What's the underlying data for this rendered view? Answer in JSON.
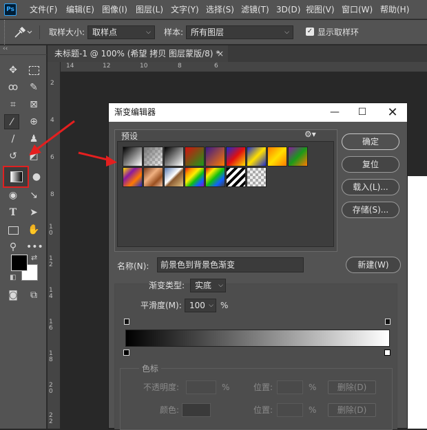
{
  "app": {
    "logo": "Ps"
  },
  "menu": [
    "文件(F)",
    "编辑(E)",
    "图像(I)",
    "图层(L)",
    "文字(Y)",
    "选择(S)",
    "滤镜(T)",
    "3D(D)",
    "视图(V)",
    "窗口(W)",
    "帮助(H)"
  ],
  "options": {
    "tool_icon": "eyedropper-icon",
    "sample_size_label": "取样大小:",
    "sample_size_value": "取样点",
    "sample_label": "样本:",
    "sample_value": "所有图层",
    "show_ring_label": "显示取样环",
    "show_ring_checked": true
  },
  "toolbar": {
    "collapse": "‹‹",
    "tools": [
      "move-icon",
      "marquee-icon",
      "lasso-icon",
      "quick-select-icon",
      "crop-icon",
      "frame-icon",
      "eyedropper-icon",
      "healing-icon",
      "brush-icon",
      "stamp-icon",
      "history-brush-icon",
      "eraser-icon",
      "gradient-icon",
      "blur-icon",
      "dodge-icon",
      "pen-icon",
      "type-icon",
      "path-select-icon",
      "rectangle-icon",
      "hand-icon",
      "zoom-icon",
      "more-icon"
    ],
    "foreground_color": "#000000",
    "background_color": "#ffffff"
  },
  "document": {
    "tab_title": "未标题-1 @ 100% (希望 拷贝 图层蒙版/8) *",
    "tab_close": "×",
    "ruler_top": [
      "14",
      "12",
      "10",
      "8",
      "6"
    ],
    "ruler_left": [
      "2",
      "4",
      "6",
      "8",
      "1 0",
      "1 2",
      "1 4",
      "1 6",
      "1 8",
      "2 0",
      "2 2"
    ]
  },
  "dialog": {
    "title": "渐变编辑器",
    "presets_label": "预设",
    "presets_menu_icon": "gear-icon",
    "buttons": {
      "ok": "确定",
      "reset": "复位",
      "load": "载入(L)...",
      "save": "存储(S)...",
      "new": "新建(W)"
    },
    "name_label": "名称(N):",
    "name_value": "前景色到背景色渐变",
    "gradient_type_label": "渐变类型:",
    "gradient_type_value": "实底",
    "smoothness_label": "平滑度(M):",
    "smoothness_value": "100",
    "smoothness_unit": "%",
    "stops_group_label": "色标",
    "opacity_label": "不透明度:",
    "opacity_unit": "%",
    "location_label": "位置:",
    "location_unit": "%",
    "delete_label": "删除(D)",
    "color_label": "颜色:",
    "location_label_2": "位置:",
    "location_unit_2": "%",
    "delete_label_2": "删除(D)"
  },
  "presets": [
    {
      "name": "fg-to-bg",
      "css": "linear-gradient(135deg,#000 0%,#fff 100%)"
    },
    {
      "name": "fg-to-transparent",
      "css": "linear-gradient(135deg,#777 0%,transparent 100%), repeating-conic-gradient(#bbb 0 25%,#eee 0 50%) 0 0/8px 8px"
    },
    {
      "name": "black-white",
      "css": "linear-gradient(135deg,#000 0%,#fff 100%)"
    },
    {
      "name": "red-green",
      "css": "linear-gradient(135deg,#d51010 0%,#1a9a1a 100%)"
    },
    {
      "name": "violet-orange",
      "css": "linear-gradient(135deg,#3a1a8a 0%,#ff7a00 100%)"
    },
    {
      "name": "blue-red-yellow",
      "css": "linear-gradient(135deg,#1a2ad0 0%,#e01010 50%,#ffe000 100%)"
    },
    {
      "name": "blue-yellow-blue",
      "css": "linear-gradient(135deg,#1a2ad0 0%,#ffe000 50%,#1a2ad0 100%)"
    },
    {
      "name": "orange-yellow-orange",
      "css": "linear-gradient(135deg,#ff7a00 0%,#ffe000 50%,#ff7a00 100%)"
    },
    {
      "name": "violet-green-orange",
      "css": "linear-gradient(135deg,#8a1aa0 0%,#1a9a1a 50%,#ff7a00 100%)"
    },
    {
      "name": "yellow-violet-orange-blue",
      "css": "linear-gradient(135deg,#ffe000 0%,#8a1aa0 33%,#ff7a00 66%,#1a2ad0 100%)"
    },
    {
      "name": "copper",
      "css": "linear-gradient(135deg,#7a3a1a 0%,#f0b080 40%,#9a5020 70%,#f0c0a0 100%)"
    },
    {
      "name": "chrome",
      "css": "linear-gradient(135deg,#5a7ab0 0%,#fff 45%,#8a5a30 55%,#e0c080 100%)"
    },
    {
      "name": "spectrum",
      "css": "linear-gradient(135deg,#e01010,#ff9900,#ffee00,#10c010,#1060ff,#9010c0)"
    },
    {
      "name": "transparent-rainbow",
      "css": "linear-gradient(135deg,#e01010,#ffee00,#10c010,#1060ff,transparent)"
    },
    {
      "name": "transparent-stripes",
      "css": "repeating-linear-gradient(135deg,#000 0 4px,#fff 4px 8px)"
    },
    {
      "name": "transparent-checker",
      "css": "repeating-conic-gradient(#aaa 0 25%,#eee 0 50%) 0 0/8px 8px"
    }
  ]
}
